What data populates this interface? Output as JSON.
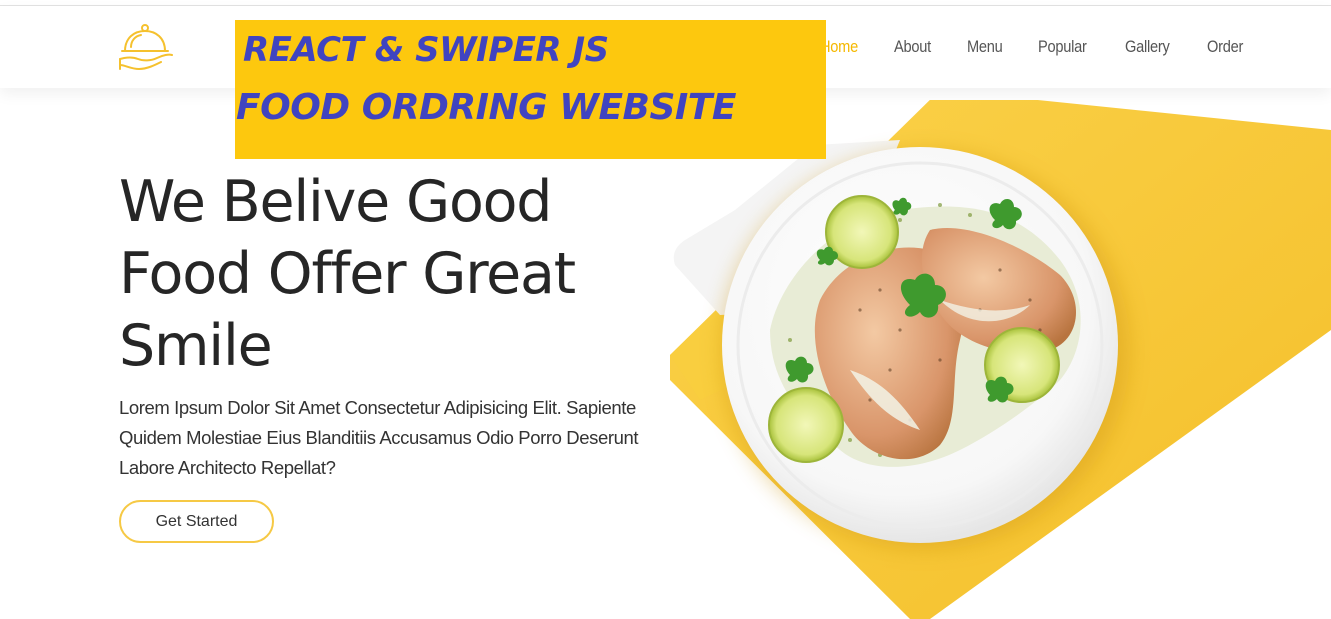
{
  "nav": {
    "logo_icon": "cloche-serving-icon",
    "links": [
      {
        "label": "Home",
        "active": true
      },
      {
        "label": "About",
        "active": false
      },
      {
        "label": "Menu",
        "active": false
      },
      {
        "label": "Popular",
        "active": false
      },
      {
        "label": "Gallery",
        "active": false
      },
      {
        "label": "Order",
        "active": false
      }
    ]
  },
  "banner": {
    "line1": "REACT & SWIPER JS",
    "line2": "FOOD ORDRING WEBSITE"
  },
  "hero": {
    "title": "We Belive Good Food Offer Great Smile",
    "text": "Lorem Ipsum Dolor Sit Amet Consectetur Adipisicing Elit. Sapiente Quidem Molestiae Eius Blanditiis Accusamus Odio Porro Deserunt Labore Architecto Repellat?",
    "cta_label": "Get Started",
    "image": "grilled-chicken-plate-with-lime-and-cilantro"
  },
  "colors": {
    "accent": "#f5b800",
    "banner_bg": "#fdc80e",
    "banner_text": "#4044c0",
    "hero_shape": "#f7c52a"
  }
}
